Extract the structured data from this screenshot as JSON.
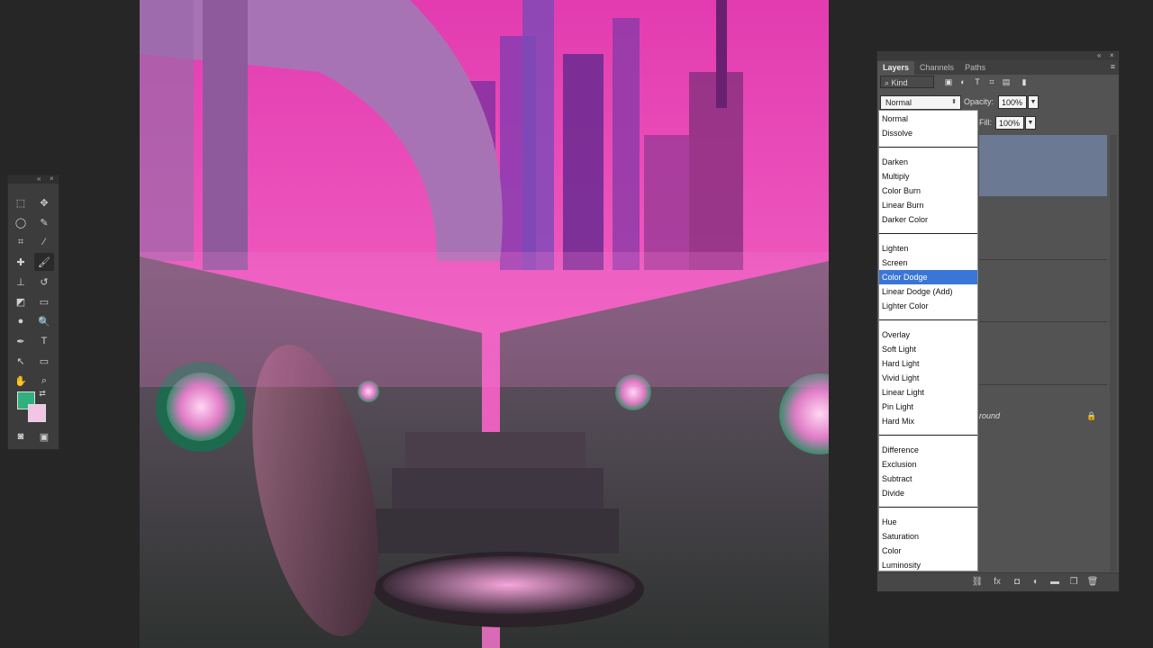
{
  "tools": {
    "items": [
      "marquee-tool",
      "move-tool",
      "lasso-tool",
      "quick-select-tool",
      "crop-tool",
      "eyedropper-tool",
      "spot-healing-tool",
      "brush-tool",
      "clone-stamp-tool",
      "history-brush-tool",
      "eraser-tool",
      "gradient-tool",
      "blur-tool",
      "dodge-tool",
      "pen-tool",
      "type-tool",
      "path-select-tool",
      "shape-tool",
      "hand-tool",
      "zoom-tool"
    ],
    "foreground_color": "#2fb07c",
    "background_color": "#f2c4e6"
  },
  "layers_panel": {
    "tabs": [
      "Layers",
      "Channels",
      "Paths"
    ],
    "kind_label": "Kind",
    "blend_mode": "Normal",
    "opacity_label": "Opacity:",
    "opacity_value": "100%",
    "fill_label": "Fill:",
    "fill_value": "100%",
    "background_layer_partial": "round",
    "selected_layer_color": "#6b7a92"
  },
  "blend_menu": {
    "groups": [
      [
        "Normal",
        "Dissolve"
      ],
      [
        "Darken",
        "Multiply",
        "Color Burn",
        "Linear Burn",
        "Darker Color"
      ],
      [
        "Lighten",
        "Screen",
        "Color Dodge",
        "Linear Dodge (Add)",
        "Lighter Color"
      ],
      [
        "Overlay",
        "Soft Light",
        "Hard Light",
        "Vivid Light",
        "Linear Light",
        "Pin Light",
        "Hard Mix"
      ],
      [
        "Difference",
        "Exclusion",
        "Subtract",
        "Divide"
      ],
      [
        "Hue",
        "Saturation",
        "Color",
        "Luminosity"
      ]
    ],
    "items": {
      "normal": "Normal",
      "dissolve": "Dissolve",
      "darken": "Darken",
      "multiply": "Multiply",
      "color_burn": "Color Burn",
      "linear_burn": "Linear Burn",
      "darker_color": "Darker Color",
      "lighten": "Lighten",
      "screen": "Screen",
      "color_dodge": "Color Dodge",
      "linear_dodge": "Linear Dodge (Add)",
      "lighter_color": "Lighter Color",
      "overlay": "Overlay",
      "soft_light": "Soft Light",
      "hard_light": "Hard Light",
      "vivid_light": "Vivid Light",
      "linear_light": "Linear Light",
      "pin_light": "Pin Light",
      "hard_mix": "Hard Mix",
      "difference": "Difference",
      "exclusion": "Exclusion",
      "subtract": "Subtract",
      "divide": "Divide",
      "hue": "Hue",
      "saturation": "Saturation",
      "color": "Color",
      "luminosity": "Luminosity"
    },
    "selected": "Color Dodge",
    "highlight_color": "#3a76d6"
  }
}
